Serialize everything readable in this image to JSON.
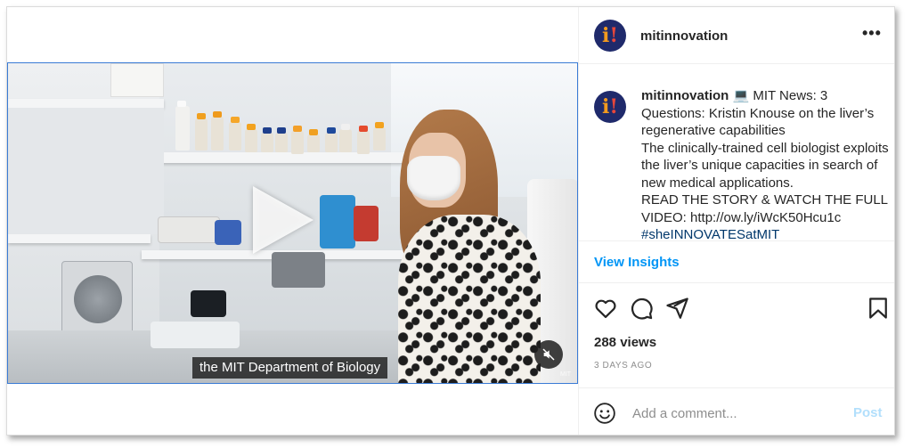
{
  "post": {
    "username": "mitinnovation",
    "avatar_mark": "i!",
    "more_label": "•••",
    "caption": {
      "username": "mitinnovation",
      "line1": " 💻 MIT News: 3 Questions: Kristin Knouse on the liver’s regenerative capabilities",
      "line2": "The clinically-trained cell biologist exploits the liver’s unique capacities in search of new medical applications.",
      "line3": "READ THE STORY & WATCH THE FULL VIDEO: http://ow.ly/iWcK50Hcu1c",
      "hashtag": "#sheINNOVATESatMIT"
    },
    "insights_label": "View Insights",
    "views": "288 views",
    "date": "3 DAYS AGO",
    "comment": {
      "placeholder": "Add a comment...",
      "value": "",
      "post_label": "Post"
    }
  },
  "video": {
    "subtitle": "the MIT Department of Biology",
    "watermark": "MIT"
  },
  "icons": {
    "avatar": "mit-innovation-logo",
    "more": "more-options-icon",
    "like": "heart-icon",
    "comment": "comment-icon",
    "share": "send-icon",
    "save": "bookmark-icon",
    "emoji": "emoji-icon",
    "mute": "muted-speaker-icon",
    "play": "play-icon"
  },
  "colors": {
    "link_blue": "#0095f6",
    "hashtag": "#00376b",
    "post_disabled": "#b2dffc",
    "avatar_bg": "#1f2a6b",
    "media_border": "#3a7bd5"
  }
}
